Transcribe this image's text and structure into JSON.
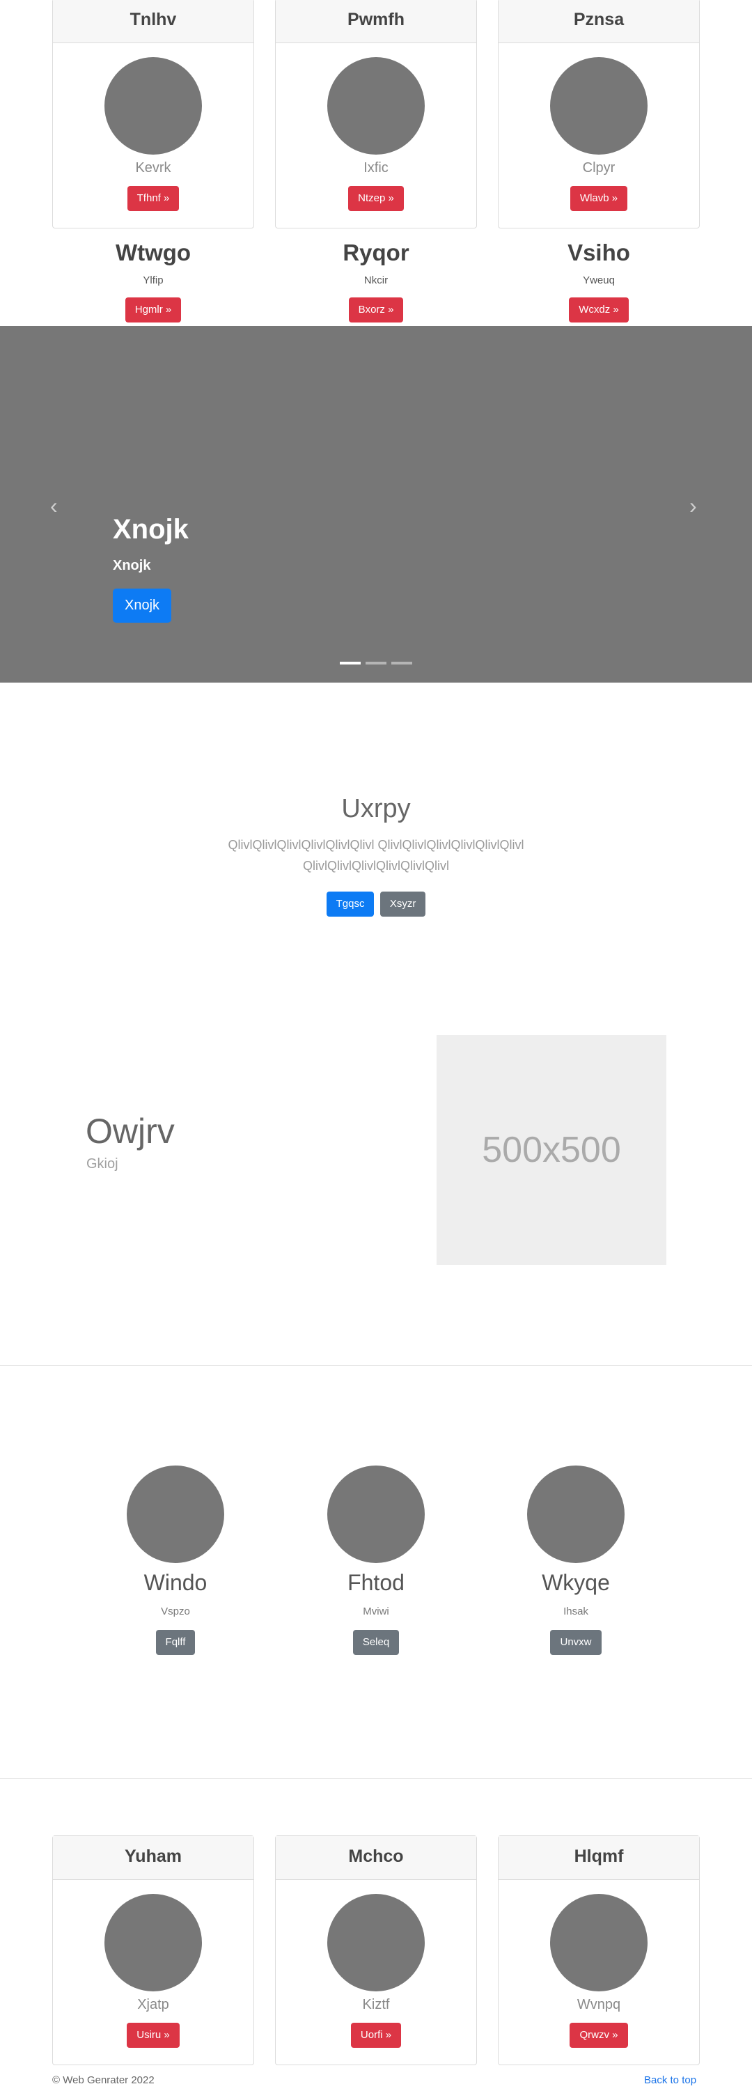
{
  "top_cards": [
    {
      "header": "Tnlhv",
      "name": "Kevrk",
      "button": "Tfhnf »"
    },
    {
      "header": "Pwmfh",
      "name": "Ixfic",
      "button": "Ntzep »"
    },
    {
      "header": "Pznsa",
      "name": "Clpyr",
      "button": "Wlavb »"
    }
  ],
  "headings_row": [
    {
      "title": "Wtwgo",
      "subtitle": "Ylfip",
      "button": "Hgmlr »"
    },
    {
      "title": "Ryqor",
      "subtitle": "Nkcir",
      "button": "Bxorz »"
    },
    {
      "title": "Vsiho",
      "subtitle": "Yweuq",
      "button": "Wcxdz »"
    }
  ],
  "carousel": {
    "prev_icon": "chevron-left-icon",
    "next_icon": "chevron-right-icon",
    "prev_glyph": "‹",
    "next_glyph": "›",
    "caption_title": "Xnojk",
    "caption_text": "Xnojk",
    "caption_button": "Xnojk",
    "background_color": "#777777",
    "indicators": 3,
    "active_indicator": 0
  },
  "jumbotron": {
    "title": "Uxrpy",
    "lead": "QlivlQlivlQlivlQlivlQlivlQlivl QlivlQlivlQlivlQlivlQlivlQlivl QlivlQlivlQlivlQlivlQlivlQlivl",
    "primary_button": "Tgqsc",
    "secondary_button": "Xsyzr"
  },
  "featurette": {
    "title": "Owjrv",
    "subtitle": "Gkioj",
    "image_label": "500x500"
  },
  "marketing": [
    {
      "title": "Windo",
      "subtitle": "Vspzo",
      "button": "Fqlff"
    },
    {
      "title": "Fhtod",
      "subtitle": "Mviwi",
      "button": "Seleq"
    },
    {
      "title": "Wkyqe",
      "subtitle": "Ihsak",
      "button": "Unvxw"
    }
  ],
  "bottom_cards": [
    {
      "header": "Yuham",
      "name": "Xjatp",
      "button": "Usiru »"
    },
    {
      "header": "Mchco",
      "name": "Kiztf",
      "button": "Uorfi »"
    },
    {
      "header": "Hlqmf",
      "name": "Wvnpq",
      "button": "Qrwzv »"
    }
  ],
  "footer": {
    "copyright": "© Web Genrater 2022",
    "back_to_top": "Back to top"
  },
  "colors": {
    "danger": "#dc3545",
    "secondary": "#6c757d",
    "primary": "#0d7bf4",
    "placeholder_circle": "#777777"
  }
}
